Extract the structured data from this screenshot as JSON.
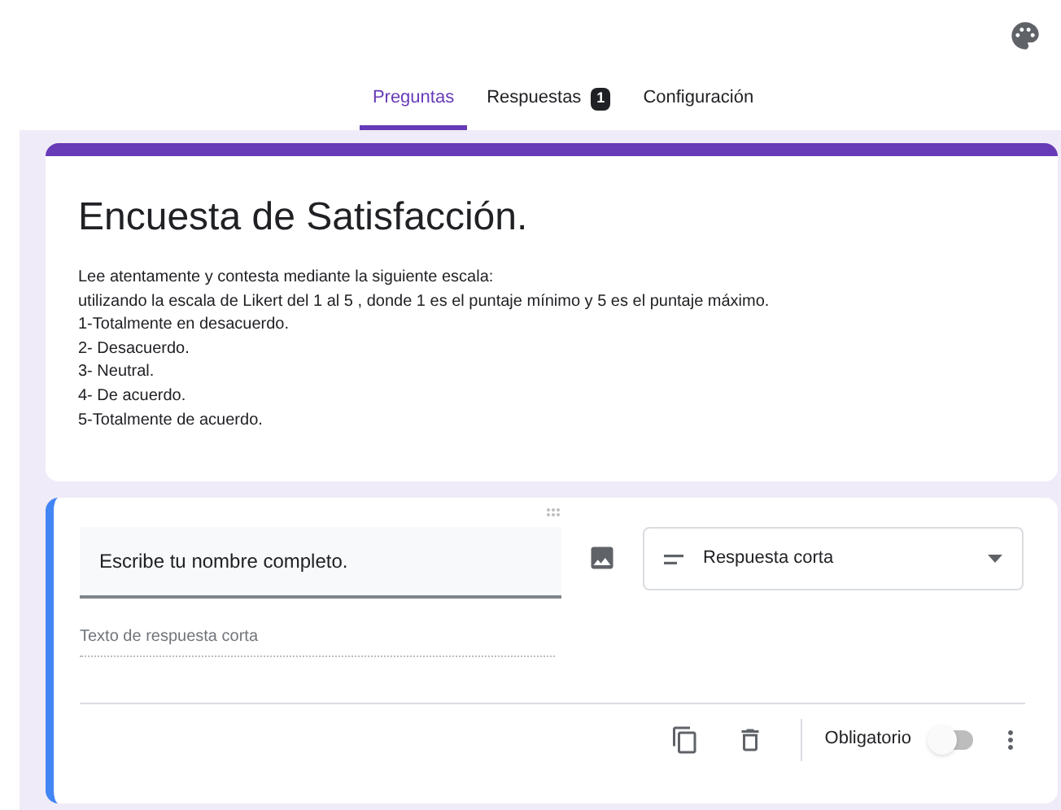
{
  "tabs": [
    {
      "label": "Preguntas",
      "selected": true
    },
    {
      "label": "Respuestas",
      "selected": false,
      "badge": "1"
    },
    {
      "label": "Configuración",
      "selected": false
    }
  ],
  "form": {
    "title": "Encuesta de Satisfacción.",
    "description": [
      "Lee atentamente y contesta mediante la siguiente escala:",
      "utilizando la escala de Likert del 1 al 5 , donde 1 es el puntaje mínimo y 5 es el puntaje máximo.",
      "1-Totalmente en desacuerdo.",
      "2- Desacuerdo.",
      "3- Neutral.",
      "4- De acuerdo.",
      "5-Totalmente de acuerdo."
    ]
  },
  "question": {
    "title": "Escribe tu nombre completo.",
    "type": "Respuesta corta",
    "answer_placeholder": "Texto de respuesta corta",
    "required_label": "Obligatorio",
    "required": false
  }
}
